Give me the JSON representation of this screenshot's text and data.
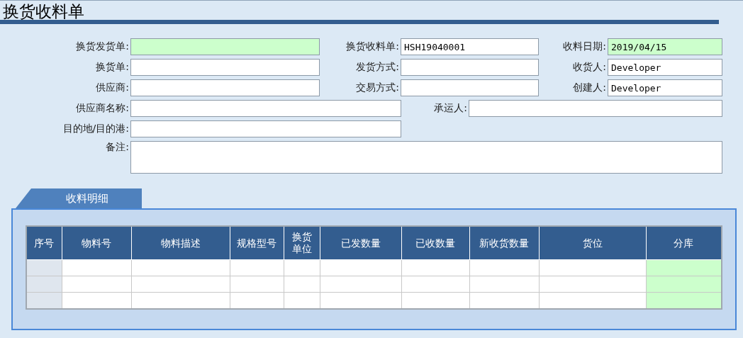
{
  "title": "换货收料单",
  "form": {
    "rows": [
      [
        {
          "label": "换货发货单:",
          "required": true
        },
        {
          "label": "换货收料单:",
          "value": "HSH19040001",
          "required": false
        },
        {
          "label": "收料日期:",
          "value": "2019/04/15",
          "required": true
        }
      ],
      [
        {
          "label": "换货单:",
          "required": false
        },
        {
          "label": "发货方式:",
          "required": false
        },
        {
          "label": "收货人:",
          "value": "Developer",
          "required": false
        }
      ],
      [
        {
          "label": "供应商:",
          "required": false
        },
        {
          "label": "交易方式:",
          "required": false
        },
        {
          "label": "创建人:",
          "value": "Developer",
          "required": false
        }
      ],
      [
        {
          "label": "供应商名称:",
          "required": false
        },
        {
          "label": "承运人:",
          "required": false
        }
      ],
      [
        {
          "label": "目的地/目的港:",
          "required": false
        }
      ],
      [
        {
          "label": "备注:",
          "kind": "textarea",
          "required": false
        }
      ]
    ]
  },
  "detail": {
    "tab": {
      "label": "收料明细",
      "selected": true
    },
    "columns": [
      {
        "label": "序号",
        "kind": "index"
      },
      {
        "label": "物料号"
      },
      {
        "label": "物料描述"
      },
      {
        "label": "规格型号"
      },
      {
        "label": "换货单位"
      },
      {
        "label": "已发数量"
      },
      {
        "label": "已收数量"
      },
      {
        "label": "新收货数量"
      },
      {
        "label": "货位"
      },
      {
        "label": "分库",
        "required": true
      }
    ]
  }
}
